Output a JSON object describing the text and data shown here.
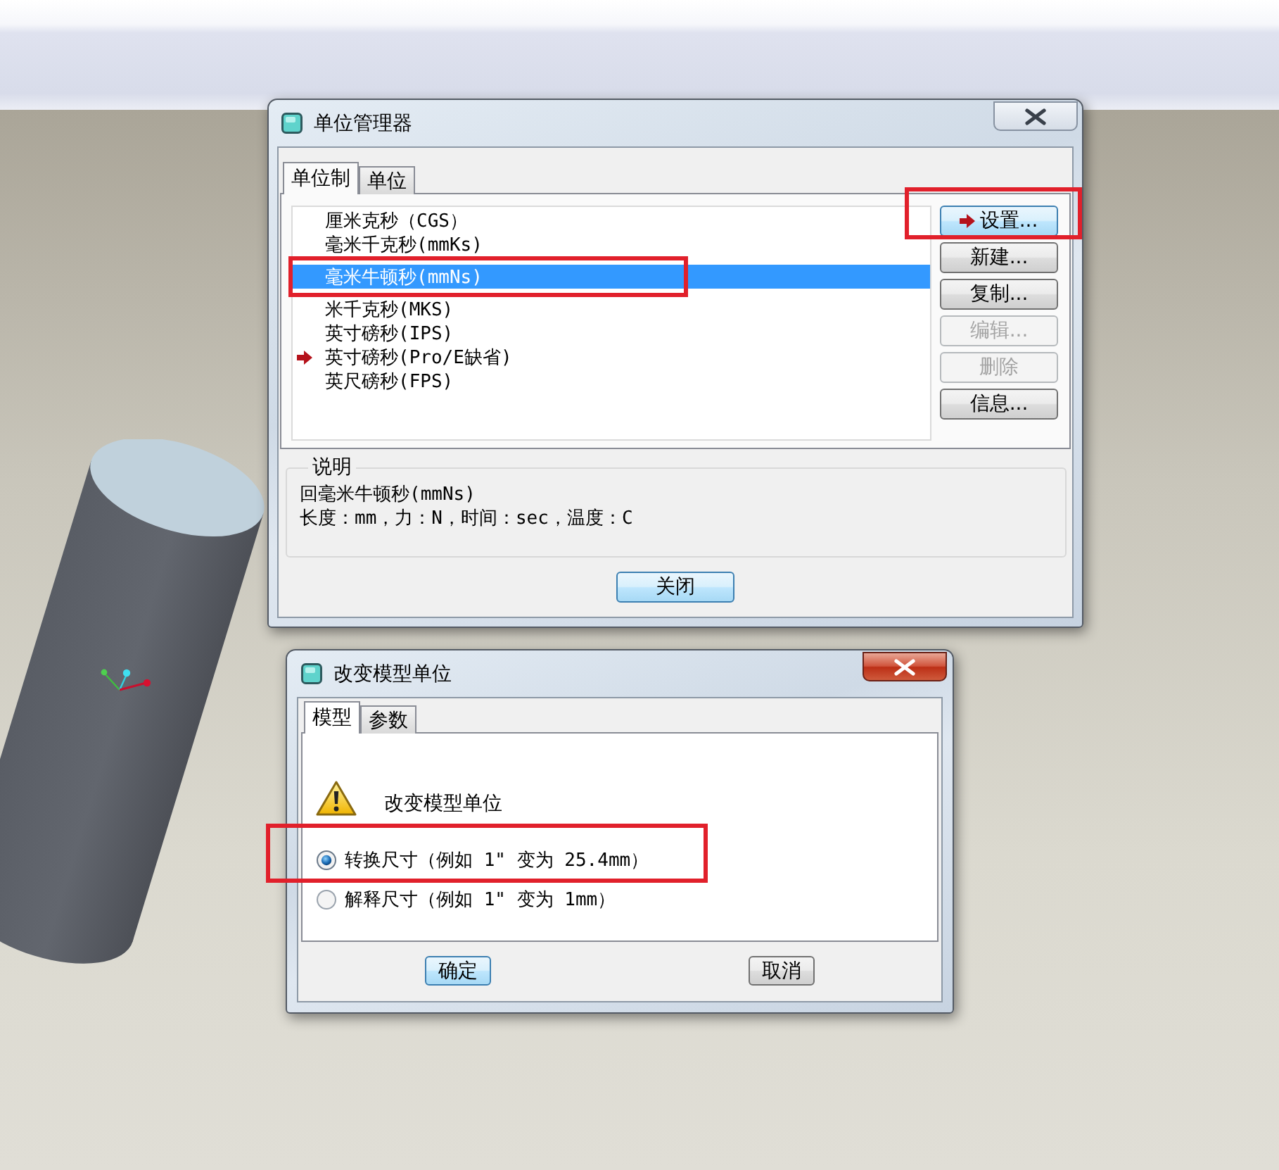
{
  "units_manager": {
    "title": "单位管理器",
    "active": false,
    "tabs": [
      {
        "label": "单位制",
        "selected": true
      },
      {
        "label": "单位",
        "selected": false
      }
    ],
    "unit_systems": [
      {
        "name": "厘米克秒（CGS）",
        "selected": false,
        "current": false,
        "highlighted": false
      },
      {
        "name": "毫米千克秒(mmKs)",
        "selected": false,
        "current": false,
        "highlighted": false
      },
      {
        "name": "毫米牛顿秒(mmNs)",
        "selected": true,
        "current": false,
        "highlighted": true
      },
      {
        "name": "米千克秒(MKS)",
        "selected": false,
        "current": false,
        "highlighted": false
      },
      {
        "name": "英寸磅秒(IPS)",
        "selected": false,
        "current": false,
        "highlighted": false
      },
      {
        "name": "英寸磅秒(Pro/E缺省)",
        "selected": false,
        "current": true,
        "highlighted": false
      },
      {
        "name": "英尺磅秒(FPS)",
        "selected": false,
        "current": false,
        "highlighted": false
      }
    ],
    "buttons": [
      {
        "label": "设置...",
        "arrow": true,
        "default": true,
        "disabled": false,
        "highlighted": true
      },
      {
        "label": "新建...",
        "arrow": false,
        "default": false,
        "disabled": false,
        "highlighted": false
      },
      {
        "label": "复制...",
        "arrow": false,
        "default": false,
        "disabled": false,
        "highlighted": false
      },
      {
        "label": "编辑...",
        "arrow": false,
        "default": false,
        "disabled": true,
        "highlighted": false
      },
      {
        "label": "删除",
        "arrow": false,
        "default": false,
        "disabled": true,
        "highlighted": false
      },
      {
        "label": "信息...",
        "arrow": false,
        "default": false,
        "disabled": false,
        "highlighted": false
      }
    ],
    "description": {
      "heading": "说明",
      "lines": [
        "回毫米牛顿秒(mmNs)",
        "长度：mm，力：N，时间：sec，温度：C"
      ]
    },
    "close_button": {
      "label": "关闭",
      "default": true
    }
  },
  "change_units": {
    "title": "改变模型单位",
    "active": true,
    "tabs": [
      {
        "label": "模型",
        "selected": true
      },
      {
        "label": "参数",
        "selected": false
      }
    ],
    "message": "改变模型单位",
    "options": [
      {
        "label": "转换尺寸（例如 1\" 变为 25.4mm）",
        "selected": true,
        "highlighted": true
      },
      {
        "label": "解释尺寸（例如 1\" 变为 1mm）",
        "selected": false,
        "highlighted": false
      }
    ],
    "buttons": [
      {
        "label": "确定",
        "default": true
      },
      {
        "label": "取消",
        "default": false
      }
    ]
  }
}
